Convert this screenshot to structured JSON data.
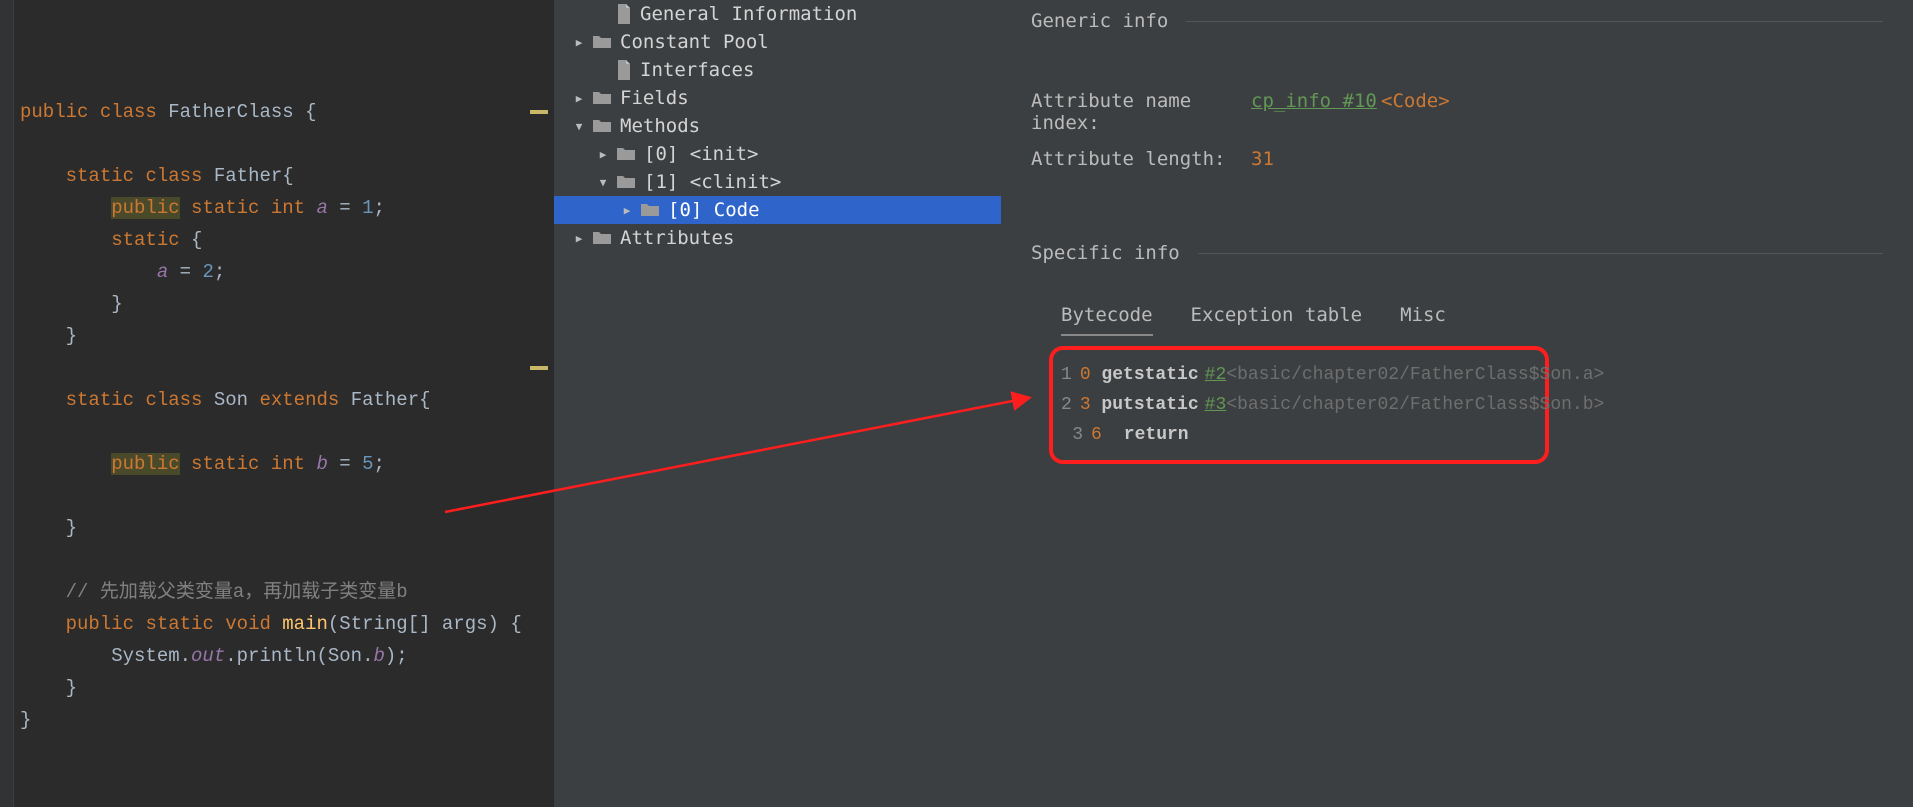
{
  "code": {
    "tokens": [
      [
        [
          "kw",
          "public "
        ],
        [
          "kw",
          "class "
        ],
        [
          "ident",
          "FatherClass {"
        ]
      ],
      [],
      [
        [
          "ident",
          "    "
        ],
        [
          "kw",
          "static "
        ],
        [
          "kw",
          "class "
        ],
        [
          "ident",
          "Father{"
        ]
      ],
      [
        [
          "ident",
          "        "
        ],
        [
          "hl kw",
          "public"
        ],
        [
          "kw",
          " static "
        ],
        [
          "kw",
          "int "
        ],
        [
          "field",
          "a"
        ],
        [
          "ident",
          " = "
        ],
        [
          "num",
          "1"
        ],
        [
          "ident",
          ";"
        ]
      ],
      [
        [
          "ident",
          "        "
        ],
        [
          "kw",
          "static "
        ],
        [
          "ident",
          "{"
        ]
      ],
      [
        [
          "ident",
          "            "
        ],
        [
          "field",
          "a"
        ],
        [
          "ident",
          " = "
        ],
        [
          "num",
          "2"
        ],
        [
          "ident",
          ";"
        ]
      ],
      [
        [
          "ident",
          "        }"
        ]
      ],
      [
        [
          "ident",
          "    }"
        ]
      ],
      [],
      [
        [
          "ident",
          "    "
        ],
        [
          "kw",
          "static "
        ],
        [
          "kw",
          "class "
        ],
        [
          "ident",
          "Son "
        ],
        [
          "kw",
          "extends "
        ],
        [
          "ident",
          "Father{"
        ]
      ],
      [],
      [
        [
          "ident",
          "        "
        ],
        [
          "hl kw",
          "public"
        ],
        [
          "kw",
          " static "
        ],
        [
          "kw",
          "int "
        ],
        [
          "field",
          "b"
        ],
        [
          "ident",
          " = "
        ],
        [
          "num",
          "5"
        ],
        [
          "ident",
          ";"
        ]
      ],
      [],
      [
        [
          "ident",
          "    }"
        ]
      ],
      [],
      [
        [
          "ident",
          "    "
        ],
        [
          "comment",
          "// 先加载父类变量a，再加载子类变量b"
        ]
      ],
      [
        [
          "ident",
          "    "
        ],
        [
          "kw",
          "public "
        ],
        [
          "kw",
          "static "
        ],
        [
          "kw",
          "void "
        ],
        [
          "method",
          "main"
        ],
        [
          "ident",
          "(String[] args) {"
        ]
      ],
      [
        [
          "ident",
          "        System."
        ],
        [
          "field",
          "out"
        ],
        [
          "ident",
          ".println(Son."
        ],
        [
          "field",
          "b"
        ],
        [
          "ident",
          ");"
        ]
      ],
      [
        [
          "ident",
          "    }"
        ]
      ],
      [
        [
          "ident",
          "}"
        ]
      ]
    ],
    "change_marks_at": [
      3,
      11
    ]
  },
  "tree": [
    {
      "indent": 42,
      "arrow": "",
      "icon": "file",
      "label": "General Information"
    },
    {
      "indent": 18,
      "arrow": "right",
      "icon": "folder",
      "label": "Constant Pool"
    },
    {
      "indent": 42,
      "arrow": "",
      "icon": "file",
      "label": "Interfaces"
    },
    {
      "indent": 18,
      "arrow": "right",
      "icon": "folder",
      "label": "Fields"
    },
    {
      "indent": 18,
      "arrow": "down",
      "icon": "folder",
      "label": "Methods"
    },
    {
      "indent": 42,
      "arrow": "right",
      "icon": "folder",
      "label": "[0] <init>"
    },
    {
      "indent": 42,
      "arrow": "down",
      "icon": "folder",
      "label": "[1] <clinit>"
    },
    {
      "indent": 66,
      "arrow": "right",
      "icon": "folder",
      "label": "[0] Code",
      "selected": true
    },
    {
      "indent": 18,
      "arrow": "right",
      "icon": "folder",
      "label": "Attributes"
    }
  ],
  "details": {
    "section_generic": "Generic info",
    "attr_name_label": "Attribute name index:",
    "attr_name_link": "cp_info #10",
    "attr_name_value": "<Code>",
    "attr_length_label": "Attribute length:",
    "attr_length_value": "31",
    "section_specific": "Specific info",
    "tabs": [
      "Bytecode",
      "Exception table",
      "Misc"
    ],
    "active_tab": 0,
    "bytecode": [
      {
        "idx": "1",
        "off": "0",
        "op": "getstatic",
        "ref": "#2",
        "cmt": "<basic/chapter02/FatherClass$Son.a>"
      },
      {
        "idx": "2",
        "off": "3",
        "op": "putstatic",
        "ref": "#3",
        "cmt": "<basic/chapter02/FatherClass$Son.b>"
      },
      {
        "idx": "3",
        "off": "6",
        "op": "return",
        "ref": "",
        "cmt": ""
      }
    ]
  }
}
